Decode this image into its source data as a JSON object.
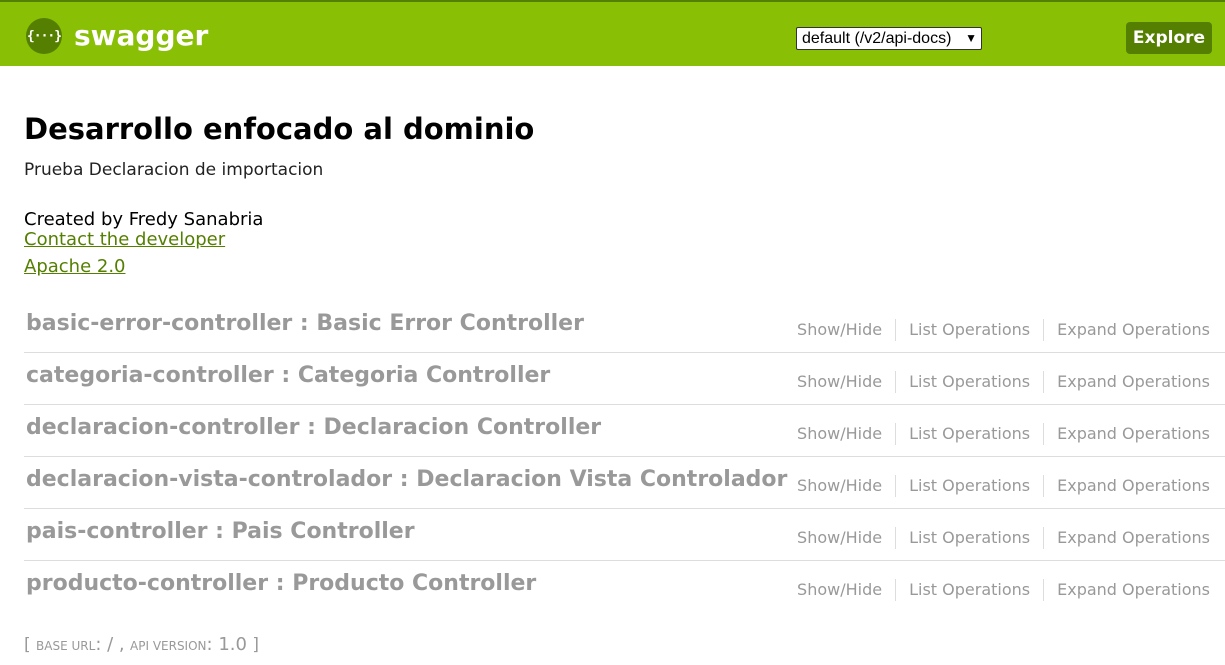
{
  "header": {
    "logo_glyph": "{···}",
    "logo_text": "swagger",
    "spec_select_value": "default (/v2/api-docs)",
    "explore_label": "Explore"
  },
  "info": {
    "title": "Desarrollo enfocado al dominio",
    "description": "Prueba Declaracion de importacion",
    "created_by": "Created by Fredy Sanabria",
    "contact_link": "Contact the developer",
    "license_link": "Apache 2.0"
  },
  "resources": [
    {
      "heading": "basic-error-controller : Basic Error Controller",
      "show_hide": "Show/Hide",
      "list_ops": "List Operations",
      "expand_ops": "Expand Operations"
    },
    {
      "heading": "categoria-controller : Categoria Controller",
      "show_hide": "Show/Hide",
      "list_ops": "List Operations",
      "expand_ops": "Expand Operations"
    },
    {
      "heading": "declaracion-controller : Declaracion Controller",
      "show_hide": "Show/Hide",
      "list_ops": "List Operations",
      "expand_ops": "Expand Operations"
    },
    {
      "heading": "declaracion-vista-controlador : Declaracion Vista Controlador",
      "show_hide": "Show/Hide",
      "list_ops": "List Operations",
      "expand_ops": "Expand Operations"
    },
    {
      "heading": "pais-controller : Pais Controller",
      "show_hide": "Show/Hide",
      "list_ops": "List Operations",
      "expand_ops": "Expand Operations"
    },
    {
      "heading": "producto-controller : Producto Controller",
      "show_hide": "Show/Hide",
      "list_ops": "List Operations",
      "expand_ops": "Expand Operations"
    }
  ],
  "footer": {
    "open_bracket": "[",
    "base_url_label": "base url",
    "base_url_value": ": / ,",
    "api_version_label": "api version",
    "api_version_value": ": 1.0",
    "close_bracket": "]"
  },
  "colors": {
    "topbar": "#89bf04",
    "accent_dark": "#547f00",
    "muted_text": "#999999"
  }
}
